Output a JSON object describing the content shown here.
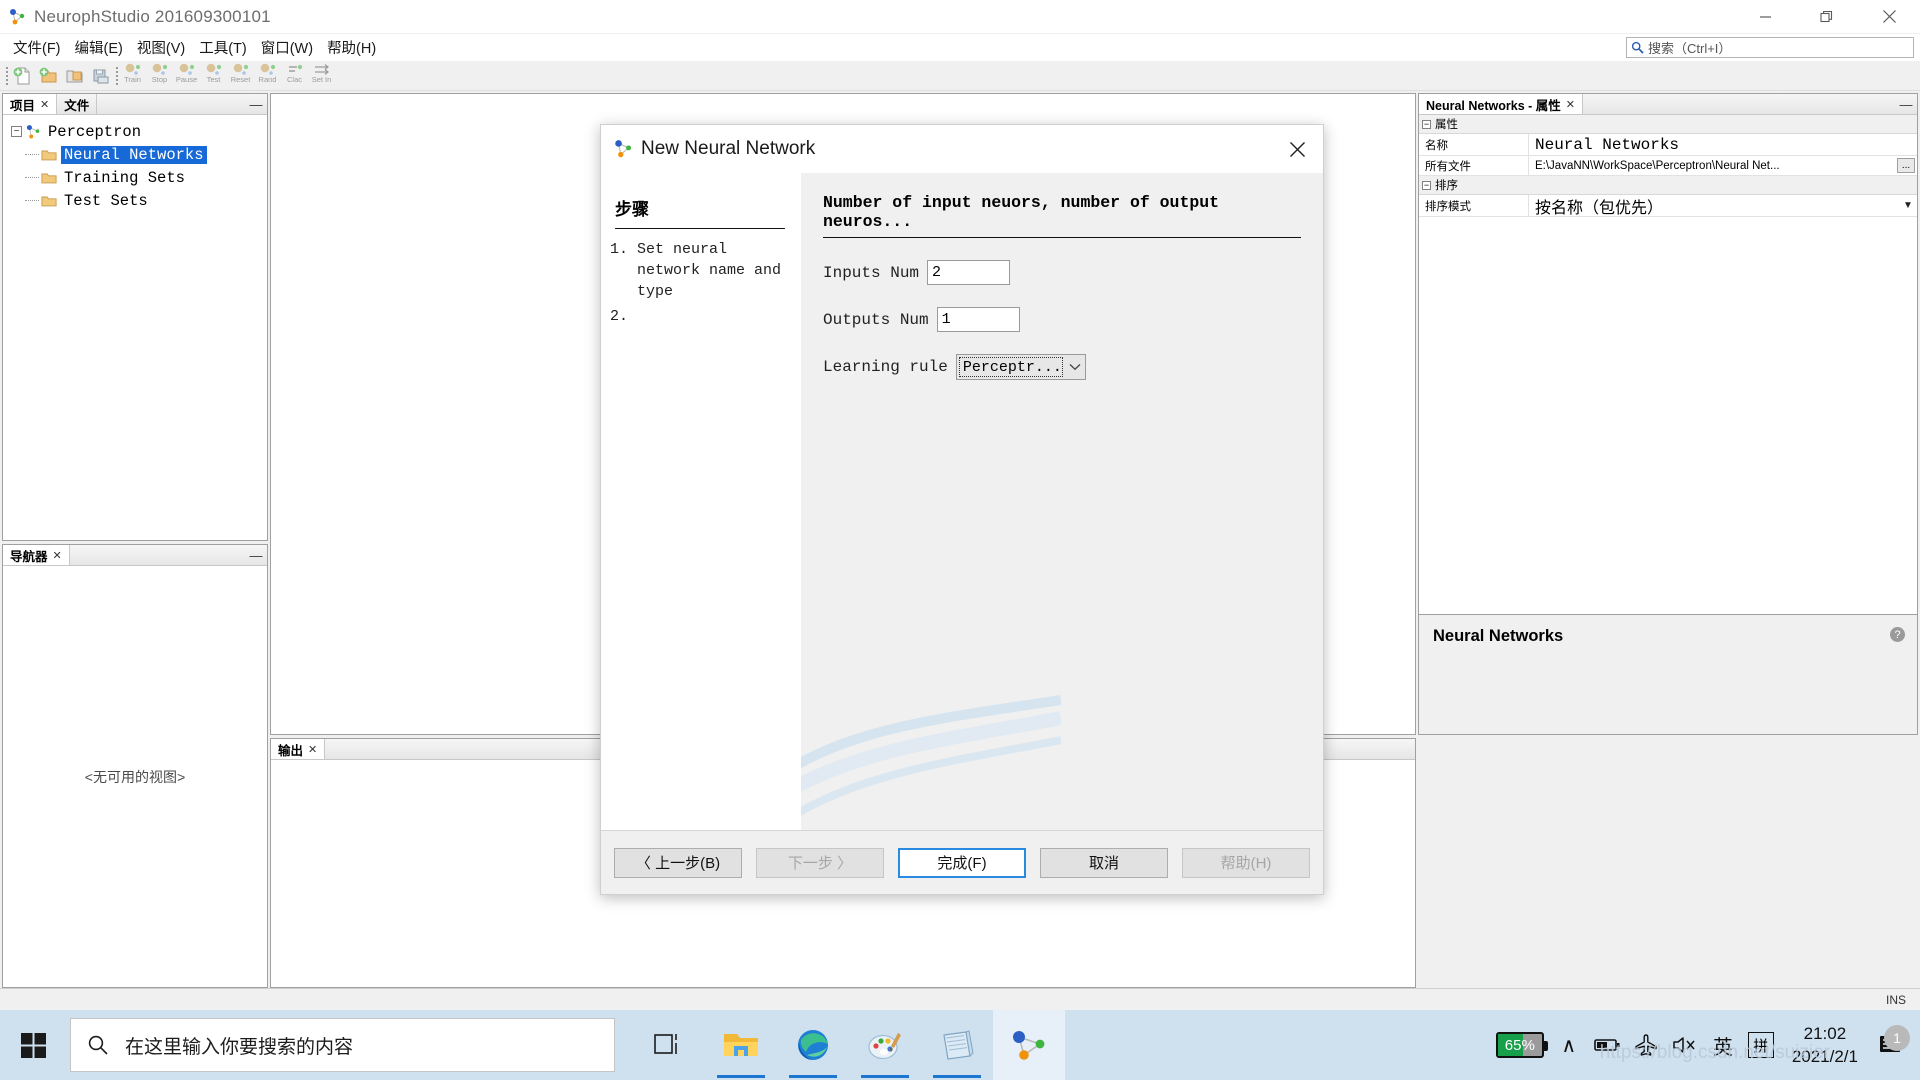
{
  "window": {
    "title": "NeurophStudio 201609300101",
    "minimize": "minimize-icon",
    "restore": "restore-icon",
    "close": "close-icon"
  },
  "menubar": {
    "items": [
      {
        "label": "文件(F)",
        "name": "menu-file"
      },
      {
        "label": "编辑(E)",
        "name": "menu-edit"
      },
      {
        "label": "视图(V)",
        "name": "menu-view"
      },
      {
        "label": "工具(T)",
        "name": "menu-tools"
      },
      {
        "label": "窗口(W)",
        "name": "menu-window"
      },
      {
        "label": "帮助(H)",
        "name": "menu-help"
      }
    ],
    "search_placeholder": "搜索（Ctrl+I）"
  },
  "toolbar": {
    "file_buttons": [
      "new-file-icon",
      "new-project-icon",
      "open-project-icon",
      "save-all-icon"
    ],
    "network_buttons": [
      {
        "label": "Train"
      },
      {
        "label": "Stop"
      },
      {
        "label": "Pause"
      },
      {
        "label": "Test"
      },
      {
        "label": "Reset"
      },
      {
        "label": "Rand"
      },
      {
        "label": "Clac"
      },
      {
        "label": "Set In"
      }
    ]
  },
  "project_panel": {
    "tabs": [
      {
        "label": "项目",
        "closable": true,
        "active": true
      },
      {
        "label": "文件",
        "closable": false,
        "active": false
      }
    ],
    "minimize": "—",
    "tree": {
      "root": "Perceptron",
      "children": [
        "Neural Networks",
        "Training Sets",
        "Test Sets"
      ],
      "selected": "Neural Networks"
    }
  },
  "navigator_panel": {
    "tab": "导航器",
    "minimize": "—",
    "empty_text": "<无可用的视图>"
  },
  "output_panel": {
    "tab": "输出"
  },
  "properties_panel": {
    "tab": "Neural Networks - 属性",
    "minimize": "—",
    "groups": [
      {
        "title": "属性",
        "rows": [
          {
            "key": "名称",
            "value": "Neural Networks",
            "type": "mono"
          },
          {
            "key": "所有文件",
            "value": "E:\\JavaNN\\WorkSpace\\Perceptron\\Neural Net...",
            "type": "path",
            "button": "..."
          }
        ]
      },
      {
        "title": "排序",
        "rows": [
          {
            "key": "排序模式",
            "value": "按名称（包优先）",
            "type": "select"
          }
        ]
      }
    ],
    "description_title": "Neural Networks",
    "help_glyph": "?"
  },
  "statusbar": {
    "insert_mode": "INS"
  },
  "dialog": {
    "title": "New Neural Network",
    "icon": "neuroph-icon",
    "close": "✕",
    "steps_heading": "步骤",
    "steps": [
      "Set neural network name and type",
      ""
    ],
    "form_heading": "Number of input neuors, number of output neuros...",
    "fields": [
      {
        "label": "Inputs Num",
        "value": "2",
        "type": "text",
        "name": "inputs-num-field"
      },
      {
        "label": "Outputs Num",
        "value": "1",
        "type": "text",
        "name": "outputs-num-field"
      },
      {
        "label": "Learning rule",
        "value": "Perceptr...",
        "type": "select",
        "name": "learning-rule-select"
      }
    ],
    "buttons": [
      {
        "label": "〈 上一步(B)",
        "state": "enabled",
        "name": "back-button"
      },
      {
        "label": "下一步 〉",
        "state": "disabled",
        "name": "next-button"
      },
      {
        "label": "完成(F)",
        "state": "default",
        "name": "finish-button"
      },
      {
        "label": "取消",
        "state": "enabled",
        "name": "cancel-button"
      },
      {
        "label": "帮助(H)",
        "state": "disabled",
        "name": "help-button"
      }
    ]
  },
  "taskbar": {
    "start": "windows-logo-icon",
    "search_placeholder": "在这里输入你要搜索的内容",
    "task_view": "task-view-icon",
    "apps": [
      {
        "name": "file-explorer-icon",
        "active": false
      },
      {
        "name": "microsoft-edge-icon",
        "active": false
      },
      {
        "name": "paint-icon",
        "active": false
      },
      {
        "name": "notepad-icon",
        "active": false
      },
      {
        "name": "neuroph-studio-icon",
        "active": true
      }
    ],
    "tray": {
      "battery_percent": "65%",
      "chevron": "∧",
      "battery_icon": "battery-icon",
      "airplane_icon": "airplane-mode-icon",
      "volume_icon": "volume-muted-icon",
      "language": "英",
      "ime": "拼",
      "time": "21:02",
      "date": "2021/2/1",
      "notification_count": "1"
    }
  },
  "watermark": "https://blog.csdn.net/suizier",
  "colors": {
    "selection_blue": "#1669d6",
    "accent_blue": "#2a8ae0",
    "taskbar_bg": "#cfe0ef",
    "battery_green": "#17a04a"
  }
}
